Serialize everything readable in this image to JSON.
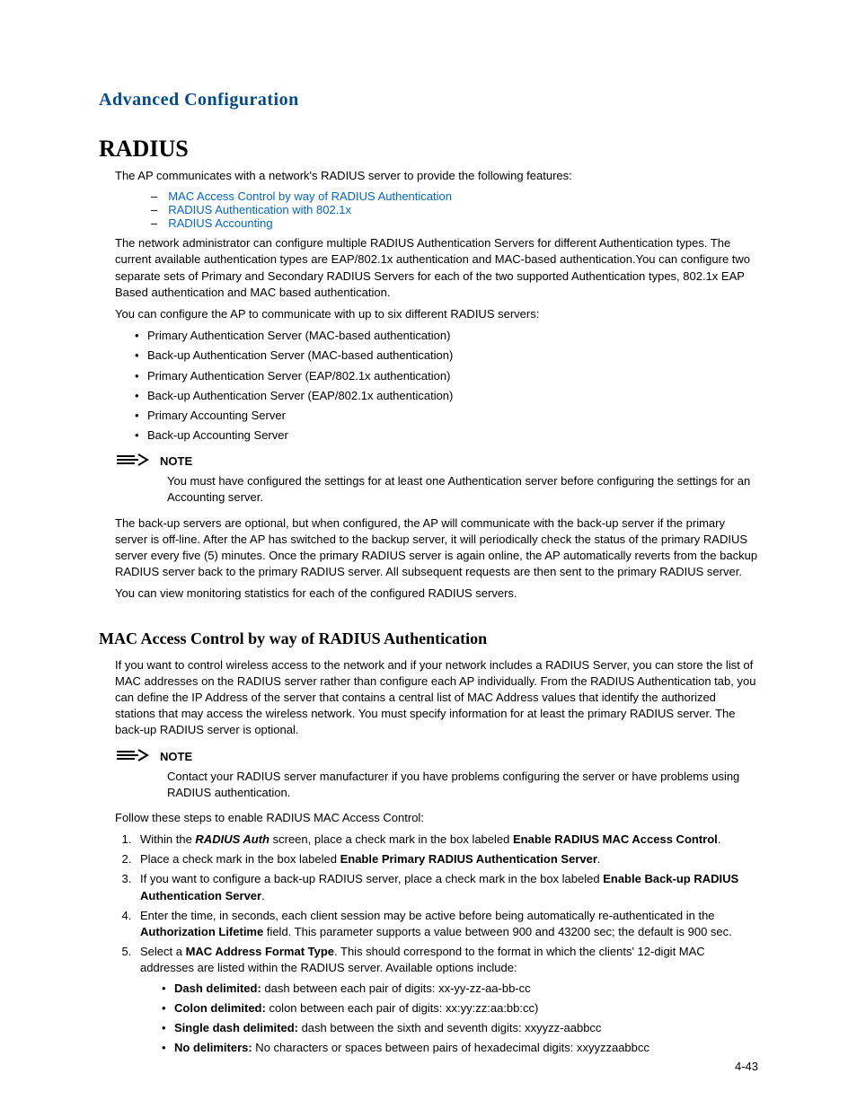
{
  "chapter": "Advanced Configuration",
  "section_title": "RADIUS",
  "intro": "The AP communicates with a network's RADIUS server to provide the following features:",
  "feature_links": [
    "MAC Access Control by way of RADIUS Authentication",
    "RADIUS Authentication with 802.1x",
    "RADIUS Accounting"
  ],
  "para_admin": "The network administrator can configure multiple RADIUS Authentication Servers for different Authentication types. The current available authentication types are EAP/802.1x authentication and MAC-based authentication.You can configure two separate sets of Primary and Secondary RADIUS Servers for each of the two supported Authentication types, 802.1x EAP Based authentication and MAC based authentication.",
  "para_six": "You can configure the AP to communicate with up to six different RADIUS servers:",
  "server_list": [
    "Primary Authentication Server (MAC-based authentication)",
    "Back-up Authentication Server (MAC-based authentication)",
    "Primary Authentication Server (EAP/802.1x authentication)",
    "Back-up Authentication Server (EAP/802.1x authentication)",
    "Primary Accounting Server",
    "Back-up Accounting Server"
  ],
  "note_label": "NOTE",
  "note1": "You must have configured the settings for at least one Authentication server before configuring the settings for an Accounting server.",
  "para_backup": "The back-up servers are optional, but when configured, the AP will communicate with the back-up server if the primary server is off-line. After the AP has switched to the backup server, it will periodically check the status of the primary RADIUS server every five (5) minutes. Once the primary RADIUS server is again online, the AP automatically reverts from the backup RADIUS server back to the primary RADIUS server. All subsequent requests are then sent to the primary RADIUS server.",
  "para_monitor": "You can view monitoring statistics for each of the configured RADIUS servers.",
  "subsection_title": "MAC Access Control by way of RADIUS Authentication",
  "para_mac": "If you want to control wireless access to the network and if your network includes a RADIUS Server, you can store the list of MAC addresses on the RADIUS server rather than configure each AP individually. From the RADIUS Authentication tab, you can define the IP Address of the server that contains a central list of MAC Address values that identify the authorized stations that may access the wireless network. You must specify information for at least the primary RADIUS server. The back-up RADIUS server is optional.",
  "note2": "Contact your RADIUS server manufacturer if you have problems configuring the server or have problems using RADIUS authentication.",
  "para_follow": "Follow these steps to enable RADIUS MAC Access Control:",
  "step1_a": "Within the ",
  "step1_b": "RADIUS Auth",
  "step1_c": " screen, place a check mark in the box labeled ",
  "step1_d": "Enable RADIUS MAC Access Control",
  "step1_e": ".",
  "step2_a": "Place a check mark in the box labeled ",
  "step2_b": "Enable Primary RADIUS Authentication Server",
  "step2_c": ".",
  "step3_a": "If you want to configure a back-up RADIUS server, place a check mark in the box labeled ",
  "step3_b": "Enable Back-up RADIUS Authentication Server",
  "step3_c": ".",
  "step4_a": "Enter the time, in seconds, each client session may be active before being automatically re-authenticated in the ",
  "step4_b": "Authorization Lifetime",
  "step4_c": " field. This parameter supports a value between 900 and 43200 sec; the default is 900 sec.",
  "step5_a": "Select a ",
  "step5_b": "MAC Address Format Type",
  "step5_c": ". This should correspond to the format in which the clients' 12-digit MAC addresses are listed within the RADIUS server. Available options include:",
  "fmt1_a": "Dash delimited:",
  "fmt1_b": " dash between each pair of digits: xx-yy-zz-aa-bb-cc",
  "fmt2_a": "Colon delimited:",
  "fmt2_b": " colon between each pair of digits: xx:yy:zz:aa:bb:cc)",
  "fmt3_a": "Single dash delimited:",
  "fmt3_b": " dash between the sixth and seventh digits: xxyyzz-aabbcc",
  "fmt4_a": "No delimiters:",
  "fmt4_b": " No characters or spaces between pairs of hexadecimal digits: xxyyzzaabbcc",
  "page_number": "4-43"
}
